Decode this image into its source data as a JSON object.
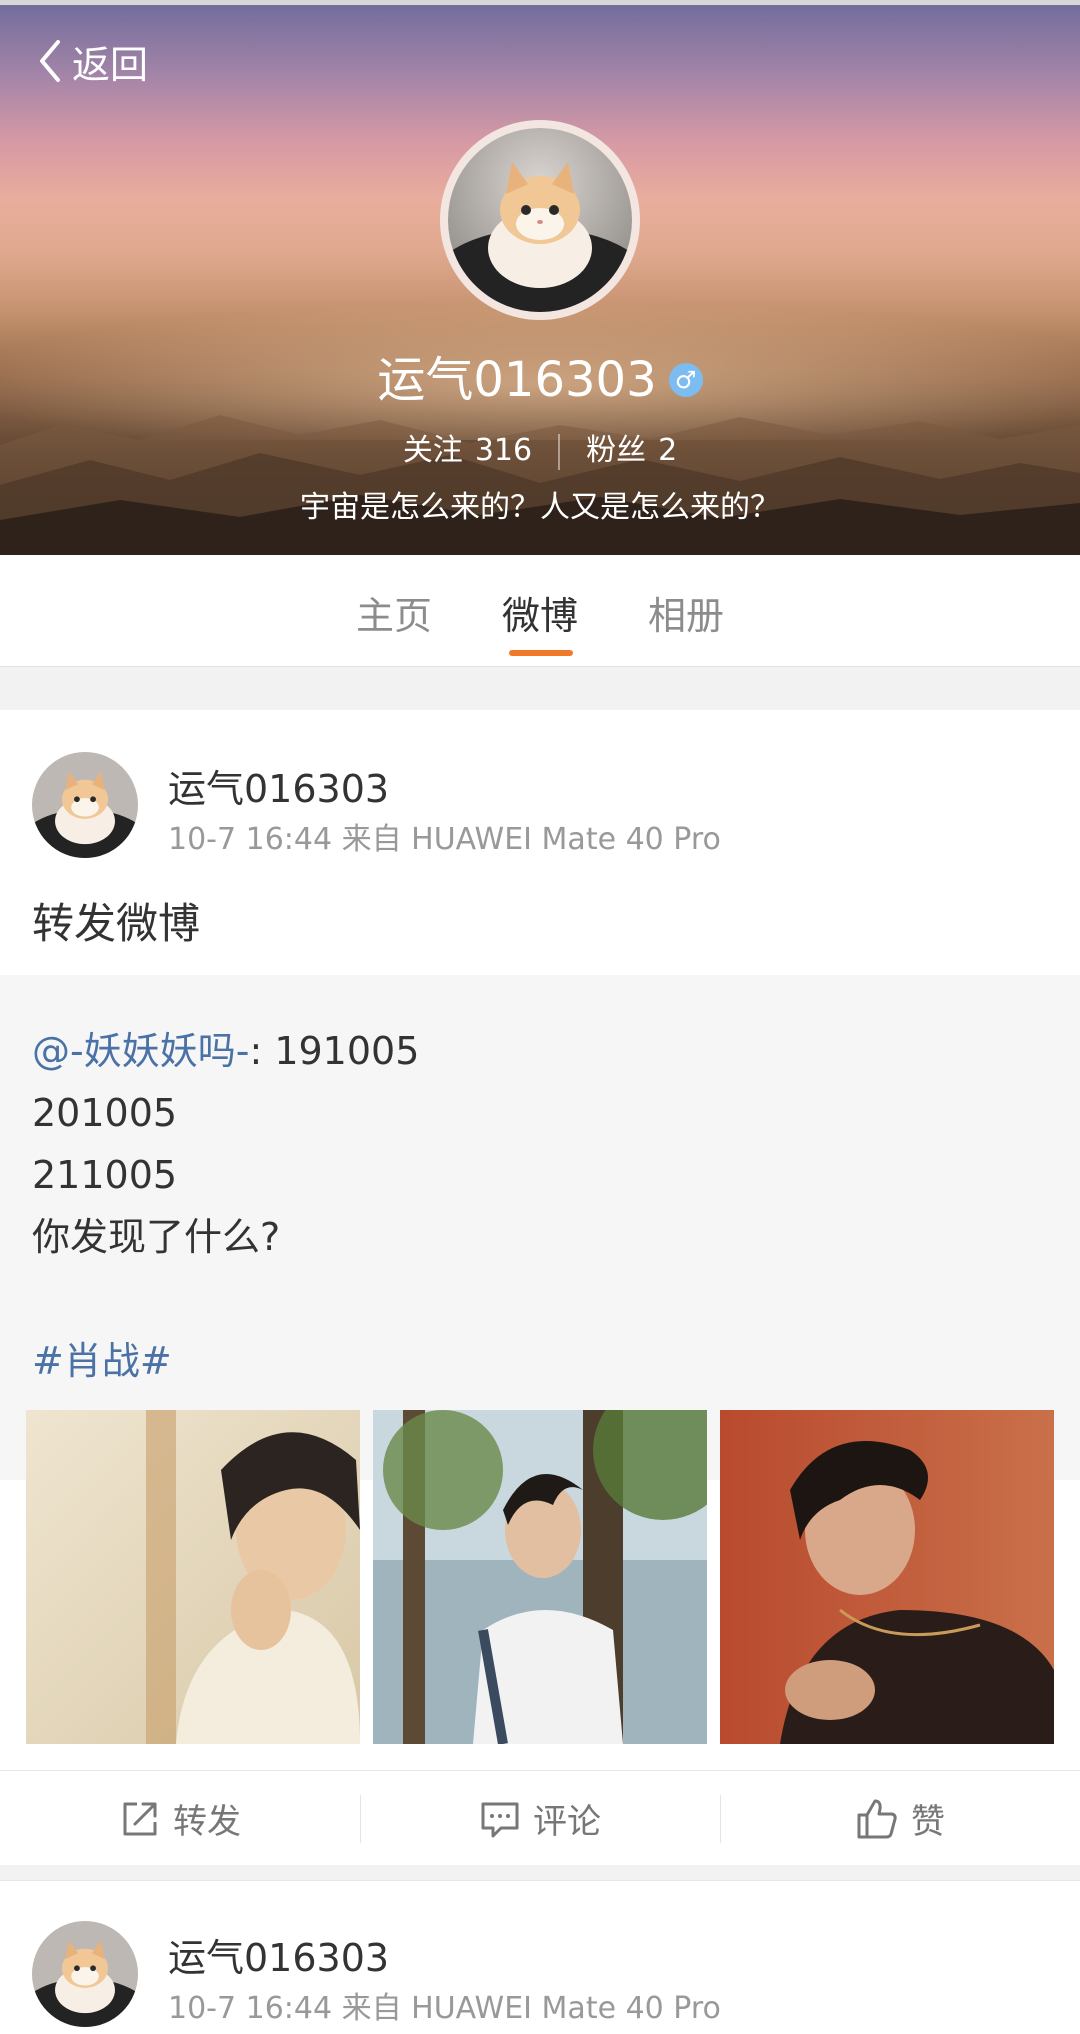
{
  "header": {
    "back_label": "返回",
    "username": "运气016303",
    "gender_symbol": "♂",
    "following_label": "关注",
    "following_count": "316",
    "followers_label": "粉丝",
    "followers_count": "2",
    "bio": "宇宙是怎么来的？人又是怎么来的？"
  },
  "tabs": [
    {
      "label": "主页",
      "active": false
    },
    {
      "label": "微博",
      "active": true
    },
    {
      "label": "相册",
      "active": false
    }
  ],
  "post": {
    "author": "运气016303",
    "meta": "10-7 16:44 来自 HUAWEI Mate 40 Pro",
    "text": "转发微博",
    "repost": {
      "mention": "@-妖妖妖吗-",
      "first_line_rest": ": 191005",
      "line2": "201005",
      "line3": "211005",
      "line4": "你发现了什么?",
      "hashtag": "#肖战#"
    },
    "actions": {
      "repost": "转发",
      "comment": "评论",
      "like": "赞"
    }
  },
  "post2": {
    "author": "运气016303",
    "meta": "10-7 16:44 来自 HUAWEI Mate 40 Pro"
  },
  "colors": {
    "accent": "#f07a2a",
    "link": "#4a72a6",
    "gender_badge": "#7cbcf1"
  }
}
